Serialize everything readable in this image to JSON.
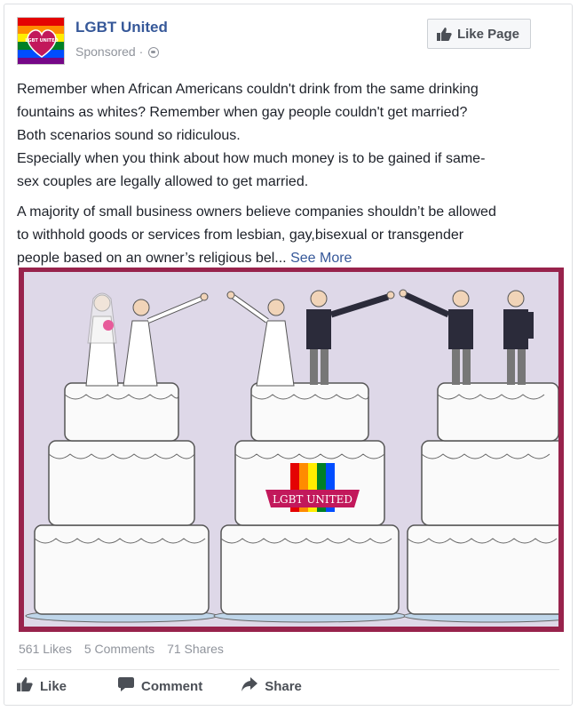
{
  "post": {
    "page_name": "LGBT United",
    "sponsored": "Sponsored",
    "sponsored_sep": "·",
    "like_page_label": "Like Page",
    "avatar_text": "LGBT UNITED",
    "paragraph1_lines": [
      "Remember when African Americans couldn't drink from the same drinking",
      "fountains as whites? Remember when gay people couldn't get married?",
      "Both scenarios sound so ridiculous.",
      "Especially when you think about how much money is to be gained if same-",
      "sex couples are legally allowed to get married."
    ],
    "paragraph2_lines": [
      "A majority of small business owners believe companies shouldn’t be allowed",
      "to withhold goods or services from lesbian, gay,bisexual or transgender",
      "people based on an owner’s religious bel..."
    ],
    "see_more": "See More",
    "banner_text": "LGBT UNITED"
  },
  "stats": {
    "likes": "561 Likes",
    "comments": "5 Comments",
    "shares": "71 Shares"
  },
  "actions": {
    "like": "Like",
    "comment": "Comment",
    "share": "Share"
  },
  "icons": {
    "globe": "globe-icon",
    "thumb": "thumbs-up-icon",
    "comment": "comment-bubble-icon",
    "share": "share-arrow-icon"
  },
  "colors": {
    "link": "#365899",
    "frame": "#98234c",
    "image_bg": "#ded8e8",
    "muted": "#90949c"
  }
}
